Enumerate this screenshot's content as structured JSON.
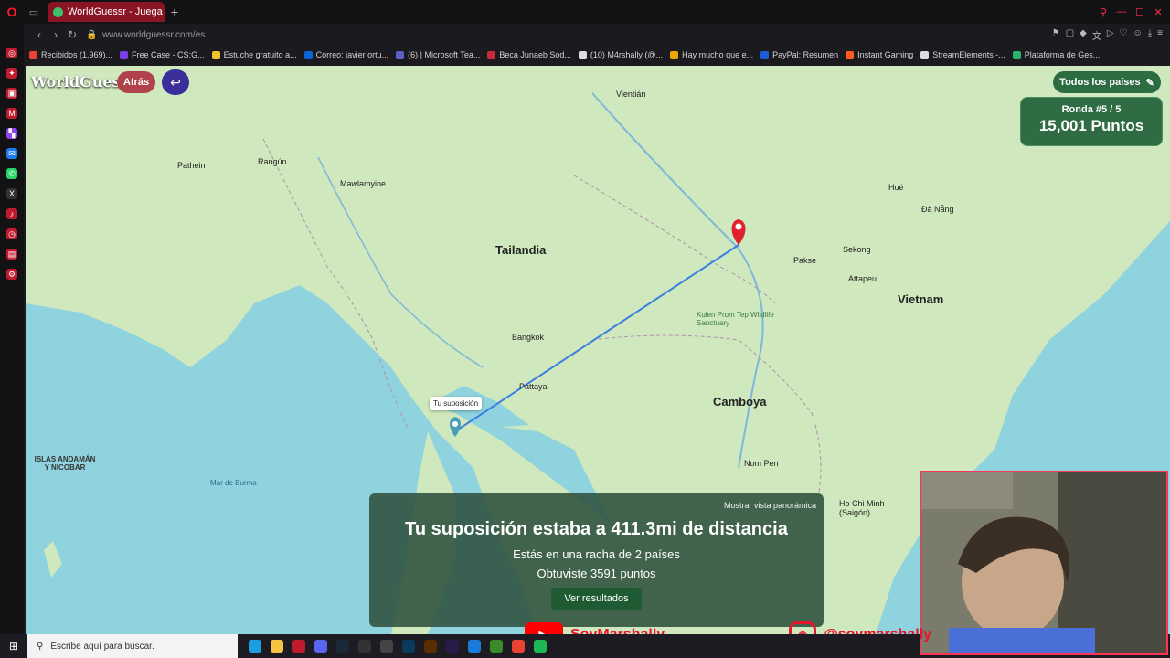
{
  "browser": {
    "tab_title": "WorldGuessr - Juega Geo...",
    "url": "www.worldguessr.com/es",
    "bookmarks": [
      {
        "label": "Recibidos (1.969)...",
        "color": "#ea4335"
      },
      {
        "label": "Free Case - CS:G...",
        "color": "#7b3fe4"
      },
      {
        "label": "Estuche gratuito a...",
        "color": "#f2c230"
      },
      {
        "label": "Correo: javier ortu...",
        "color": "#0a64d6"
      },
      {
        "label": "(6) | Microsoft Tea...",
        "color": "#5b5fc7"
      },
      {
        "label": "Beca Junaeb Sod...",
        "color": "#c92a3a"
      },
      {
        "label": "(10) M4rshally (@...",
        "color": "#dddddd"
      },
      {
        "label": "Hay mucho que e...",
        "color": "#f0a500"
      },
      {
        "label": "PayPal: Resumen",
        "color": "#1d5bd6"
      },
      {
        "label": "Instant Gaming",
        "color": "#ff5a1f"
      },
      {
        "label": "StreamElements -...",
        "color": "#dddddd"
      },
      {
        "label": "Plataforma de Ges...",
        "color": "#2ab26a"
      }
    ]
  },
  "game": {
    "logo": "WorldGuessr",
    "back_label": "Atrás",
    "all_countries_label": "Todos los países",
    "round_label": "Ronda #5 / 5",
    "points_label": "15,001 Puntos",
    "guess_pin_label": "Tu suposición"
  },
  "map": {
    "countries": [
      "Tailandia",
      "Camboya",
      "Vietnam"
    ],
    "cities": [
      "Bangkok",
      "Vientián",
      "Nom Pen",
      "Đà Nẵng",
      "Hué",
      "Pakse",
      "Sekong",
      "Attapeu",
      "Pattaya",
      "Rangún",
      "Pathein",
      "Mawlamyine"
    ],
    "misc_labels": [
      "Mar de Burma",
      "ISLAS ANDAMÁN Y NICOBAR",
      "Kulen Prom Tep Wildlife Sanctuary",
      "Ho Chi Minh (Saigón)"
    ]
  },
  "result": {
    "panorama_label": "Mostrar vista panorámica",
    "title": "Tu suposición estaba a 411.3mi de distancia",
    "streak": "Estás en una racha de 2 países",
    "points": "Obtuviste 3591 puntos",
    "view_results": "Ver resultados"
  },
  "overlay": {
    "youtube_handle": "SoyMarshally",
    "instagram_handle": "@soymarshally"
  },
  "taskbar": {
    "search_placeholder": "Escribe aquí para buscar."
  },
  "colors": {
    "water": "#8fd3de",
    "land": "#cfe8bd",
    "line": "#3a7ee0",
    "pin": "#e0212f"
  }
}
